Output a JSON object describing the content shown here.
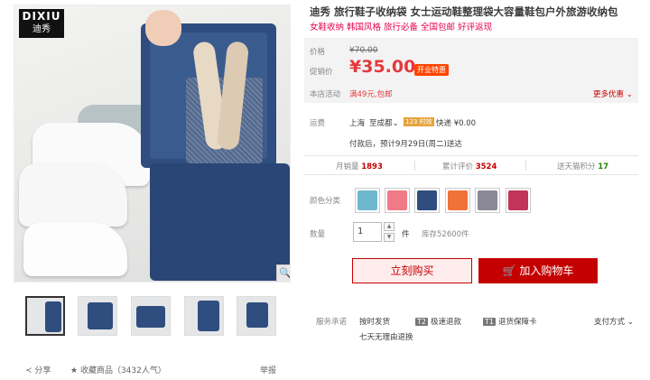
{
  "gallery": {
    "logo_line1": "DIXIU",
    "logo_line2": "迪秀",
    "zoom_icon": "🔍",
    "share_label": "分享",
    "fav_label": "收藏商品",
    "fav_count": "（3432人气）",
    "report_label": "举报"
  },
  "product": {
    "title": "迪秀 旅行鞋子收纳袋 女士运动鞋整理袋大容量鞋包户外旅游收纳包",
    "subtitle": "女鞋收纳 韩国风格 旅行必备 全国包邮 好评返现",
    "price_label": "价格",
    "original_price": "¥70.00",
    "promo_label": "促销价",
    "promo_price": "¥35.00",
    "promo_tag": "开业特惠",
    "activity_label": "本店活动",
    "activity_text": "满49元,包邮",
    "more_offers": "更多优惠",
    "shipping_label": "运费",
    "ship_from": "上海",
    "ship_to": "至成都",
    "delivery_badge": "123 时效",
    "express": "快递 ¥0.00",
    "ship_note": "付款后，预计9月29日(周二)送达",
    "monthly_sales_label": "月销量",
    "monthly_sales": "1893",
    "reviews_label": "累计评价",
    "reviews": "3524",
    "points_label": "送天猫积分",
    "points": "17",
    "color_label": "颜色分类",
    "colors": [
      "#6fb7cf",
      "#f07a86",
      "#2f4d7e",
      "#f07238",
      "#8a8894",
      "#c2345a"
    ],
    "qty_label": "数量",
    "qty_value": "1",
    "qty_unit": "件",
    "stock": "库存52600件",
    "buy_label": "立刻购买",
    "cart_label": "加入购物车",
    "service_label": "服务承诺",
    "service1": "按时发货",
    "service2_badge": "T2",
    "service2": "极速退款",
    "service3_badge": "T1",
    "service3": "退货保障卡",
    "service4": "七天无理由退换",
    "payment": "支付方式"
  },
  "colors": {
    "accent": "#c40000",
    "price": "#e4393c",
    "subtitle": "#e5004f"
  }
}
